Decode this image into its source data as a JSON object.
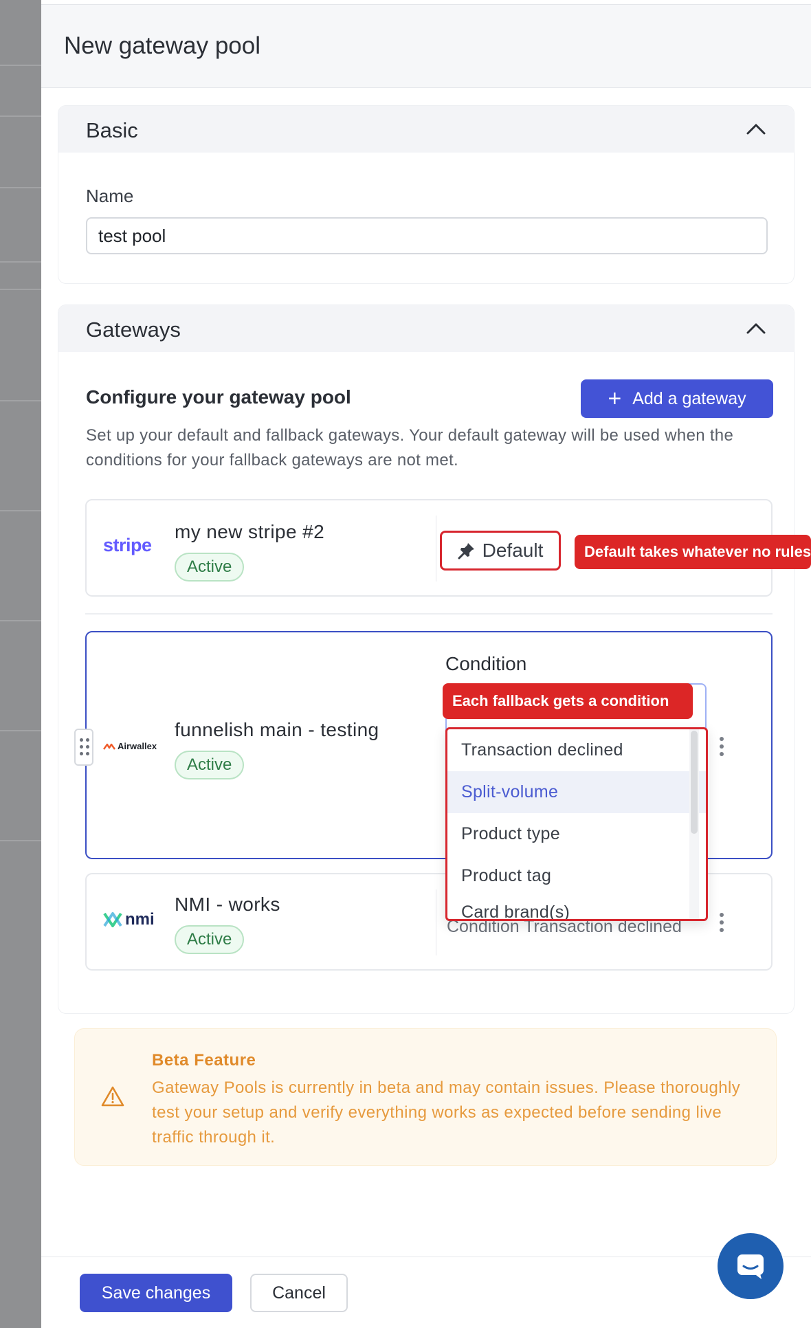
{
  "panel": {
    "title": "New gateway pool"
  },
  "basic": {
    "title": "Basic",
    "name_label": "Name",
    "name_value": "test pool"
  },
  "gateways": {
    "title": "Gateways",
    "config_title": "Configure your gateway pool",
    "add_button": "Add a gateway",
    "description": "Set up your default and fallback gateways. Your default gateway will be used when the conditions for your fallback gateways are not met.",
    "items": [
      {
        "logo": "stripe",
        "name": "my new stripe #2",
        "status": "Active",
        "role": "Default"
      },
      {
        "logo": "Airwallex",
        "name": "funnelish main - testing",
        "status": "Active",
        "condition_label": "Condition"
      },
      {
        "logo": "nmi",
        "name": "NMI - works",
        "status": "Active",
        "condition_text": "Condition Transaction declined"
      }
    ]
  },
  "annotations": {
    "default_callout": "Default takes whatever no rules",
    "condition_callout": "Each fallback gets a condition"
  },
  "condition_menu": {
    "options": [
      "Transaction declined",
      "Split-volume",
      "Product type",
      "Product tag",
      "Card brand(s)"
    ],
    "highlighted": "Split-volume"
  },
  "beta": {
    "title": "Beta Feature",
    "text": "Gateway Pools is currently in beta and may contain issues. Please thoroughly test your setup and verify everything works as expected before sending live traffic through it."
  },
  "footer": {
    "save": "Save changes",
    "cancel": "Cancel"
  },
  "colors": {
    "primary": "#4353d6",
    "danger_annotation": "#dc2626",
    "active_badge": "#2f7d47",
    "beta_text": "#e08a2a"
  },
  "icons": [
    "chevron-up-icon",
    "plus-icon",
    "pin-icon",
    "drag-handle-icon",
    "kebab-icon",
    "warning-icon",
    "chat-icon"
  ]
}
